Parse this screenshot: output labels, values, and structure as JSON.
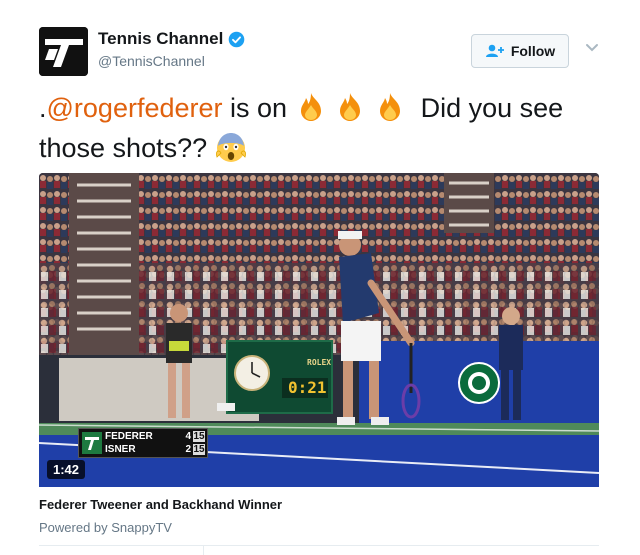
{
  "header": {
    "display_name": "Tennis Channel",
    "handle": "@TennisChannel",
    "follow_label": "Follow",
    "avatar_icon": "tennis-channel-logo-icon",
    "verified_icon": "verified-badge-icon"
  },
  "tweet": {
    "prefix": ".",
    "mention": "@rogerfederer",
    "text_middle": " is on ",
    "emoji_fire": "fire-emoji",
    "text_after_fire": "Did you see those shots?? ",
    "emoji_scream": "screaming-face-emoji"
  },
  "media": {
    "duration": "1:42",
    "scorebug": {
      "player1": "FEDERER",
      "player1_score": "4",
      "player1_game": "15",
      "player2": "ISNER",
      "player2_score": "2",
      "player2_game": "15"
    },
    "board_brand": "ROLEX",
    "board_time": "0:21"
  },
  "card": {
    "title": "Federer Tweener and Backhand Winner",
    "powered_by": "Powered by SnappyTV"
  },
  "colors": {
    "mention": "#e0610e",
    "verified": "#1da1f2",
    "court_blue": "#1f3fa8",
    "court_green": "#4f8a5a"
  }
}
